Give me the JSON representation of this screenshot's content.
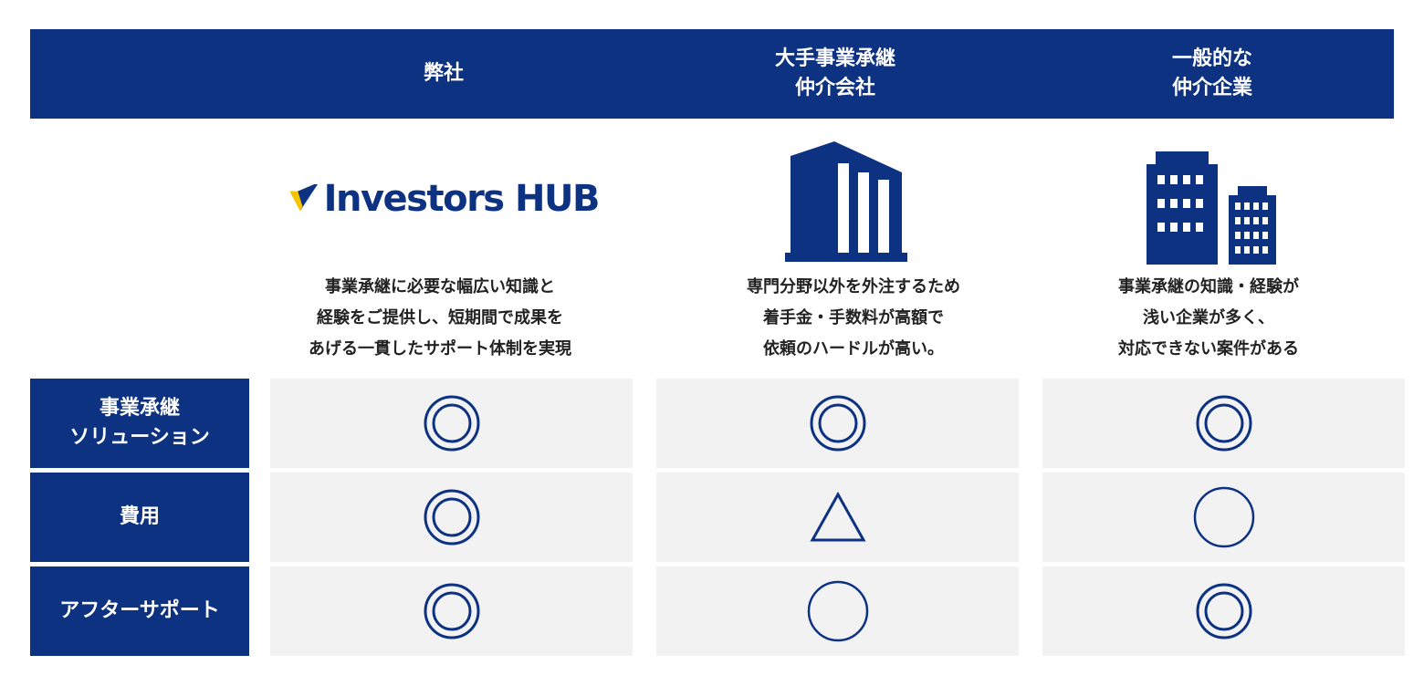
{
  "colors": {
    "navy": "#0d3282",
    "cell_bg": "#f2f2f2",
    "logo_yellow": "#f5c400"
  },
  "columns": [
    {
      "header": "弊社",
      "logo_text": "Investors HUB",
      "icon": "investors-hub-logo",
      "description": "事業承継に必要な幅広い知識と\n経験をご提供し、短期間で成果を\nあげる一貫したサポート体制を実現"
    },
    {
      "header": "大手事業承継\n仲介会社",
      "icon": "large-building-icon",
      "description": "専門分野以外を外注するため\n着手金・手数料が高額で\n依頼のハードルが高い。"
    },
    {
      "header": "一般的な\n仲介企業",
      "icon": "office-buildings-icon",
      "description": "事業承継の知識・経験が\n浅い企業が多く、\n対応できない案件がある"
    }
  ],
  "rows": [
    {
      "label": "事業承継\nソリューション",
      "ratings": [
        "double-circle",
        "double-circle",
        "double-circle"
      ]
    },
    {
      "label": "費用",
      "ratings": [
        "double-circle",
        "triangle",
        "circle"
      ]
    },
    {
      "label": "アフターサポート",
      "ratings": [
        "double-circle",
        "circle",
        "double-circle"
      ]
    }
  ]
}
